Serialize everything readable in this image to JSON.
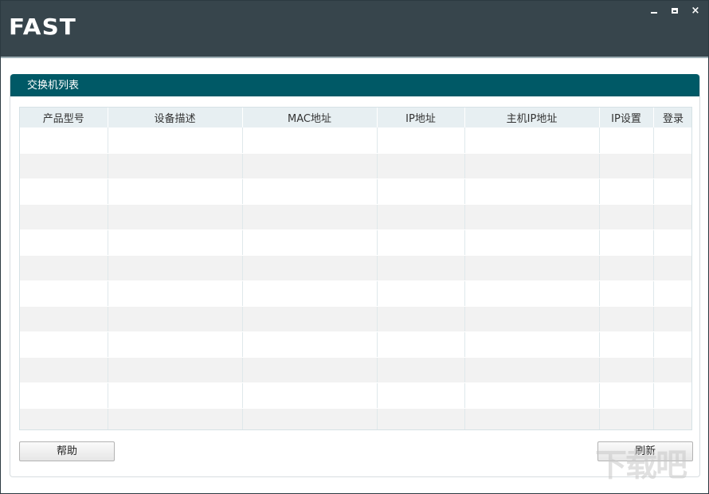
{
  "window": {
    "logo": "FAST",
    "controls": {
      "minimize": "minimize-icon",
      "maximize": "maximize-icon",
      "close": "×"
    }
  },
  "panel": {
    "title": "交换机列表",
    "columns": [
      "产品型号",
      "设备描述",
      "MAC地址",
      "IP地址",
      "主机IP地址",
      "IP设置",
      "登录"
    ],
    "rows": 12
  },
  "buttons": {
    "help": "帮助",
    "refresh": "刷新"
  },
  "watermark": {
    "text": "下载吧"
  },
  "colors": {
    "titlebar": "#37454c",
    "panel_header": "#005966",
    "table_header": "#e7eff2",
    "row_alt": "#f2f2f2"
  }
}
